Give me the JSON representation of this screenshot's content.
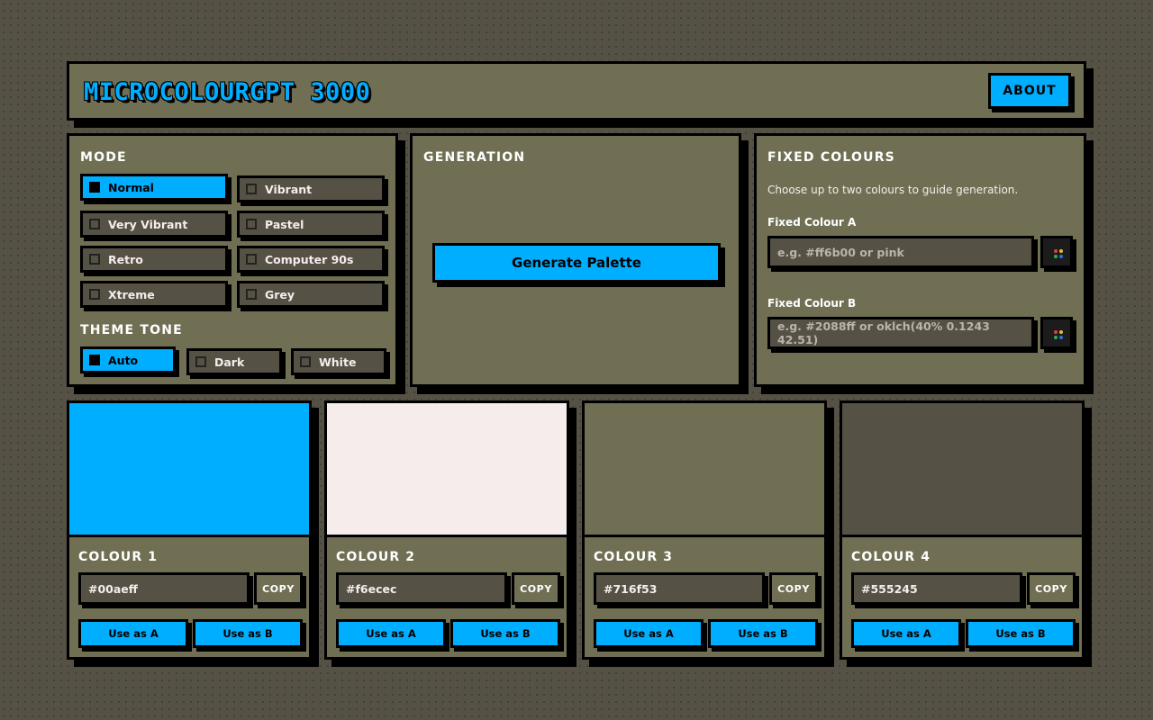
{
  "app": {
    "title": "MICROCOLOURGPT 3000",
    "about_label": "ABOUT"
  },
  "mode": {
    "title": "MODE",
    "selected": "Normal",
    "options": [
      "Normal",
      "Vibrant",
      "Very Vibrant",
      "Pastel",
      "Retro",
      "Computer 90s",
      "Xtreme",
      "Grey"
    ]
  },
  "theme_tone": {
    "title": "THEME TONE",
    "selected": "Auto",
    "options": [
      "Auto",
      "Dark",
      "White"
    ]
  },
  "generation": {
    "title": "GENERATION",
    "button_label": "Generate Palette"
  },
  "fixed": {
    "title": "FIXED COLOURS",
    "help": "Choose up to two colours to guide generation.",
    "a_label": "Fixed Colour A",
    "a_placeholder": "e.g. #ff6b00 or pink",
    "b_label": "Fixed Colour B",
    "b_placeholder": "e.g. #2088ff or oklch(40% 0.1243 42.51)",
    "picker_icon": "palette-icon"
  },
  "colours": [
    {
      "title": "COLOUR 1",
      "hex": "#00aeff",
      "copy": "COPY",
      "use_a": "Use as A",
      "use_b": "Use as B"
    },
    {
      "title": "COLOUR 2",
      "hex": "#f6ecec",
      "copy": "COPY",
      "use_a": "Use as A",
      "use_b": "Use as B"
    },
    {
      "title": "COLOUR 3",
      "hex": "#716f53",
      "copy": "COPY",
      "use_a": "Use as A",
      "use_b": "Use as B"
    },
    {
      "title": "COLOUR 4",
      "hex": "#555245",
      "copy": "COPY",
      "use_a": "Use as A",
      "use_b": "Use as B"
    }
  ],
  "theme_colors": {
    "accent": "#00aeff",
    "panel": "#716f53",
    "field": "#555245",
    "border": "#000000"
  }
}
